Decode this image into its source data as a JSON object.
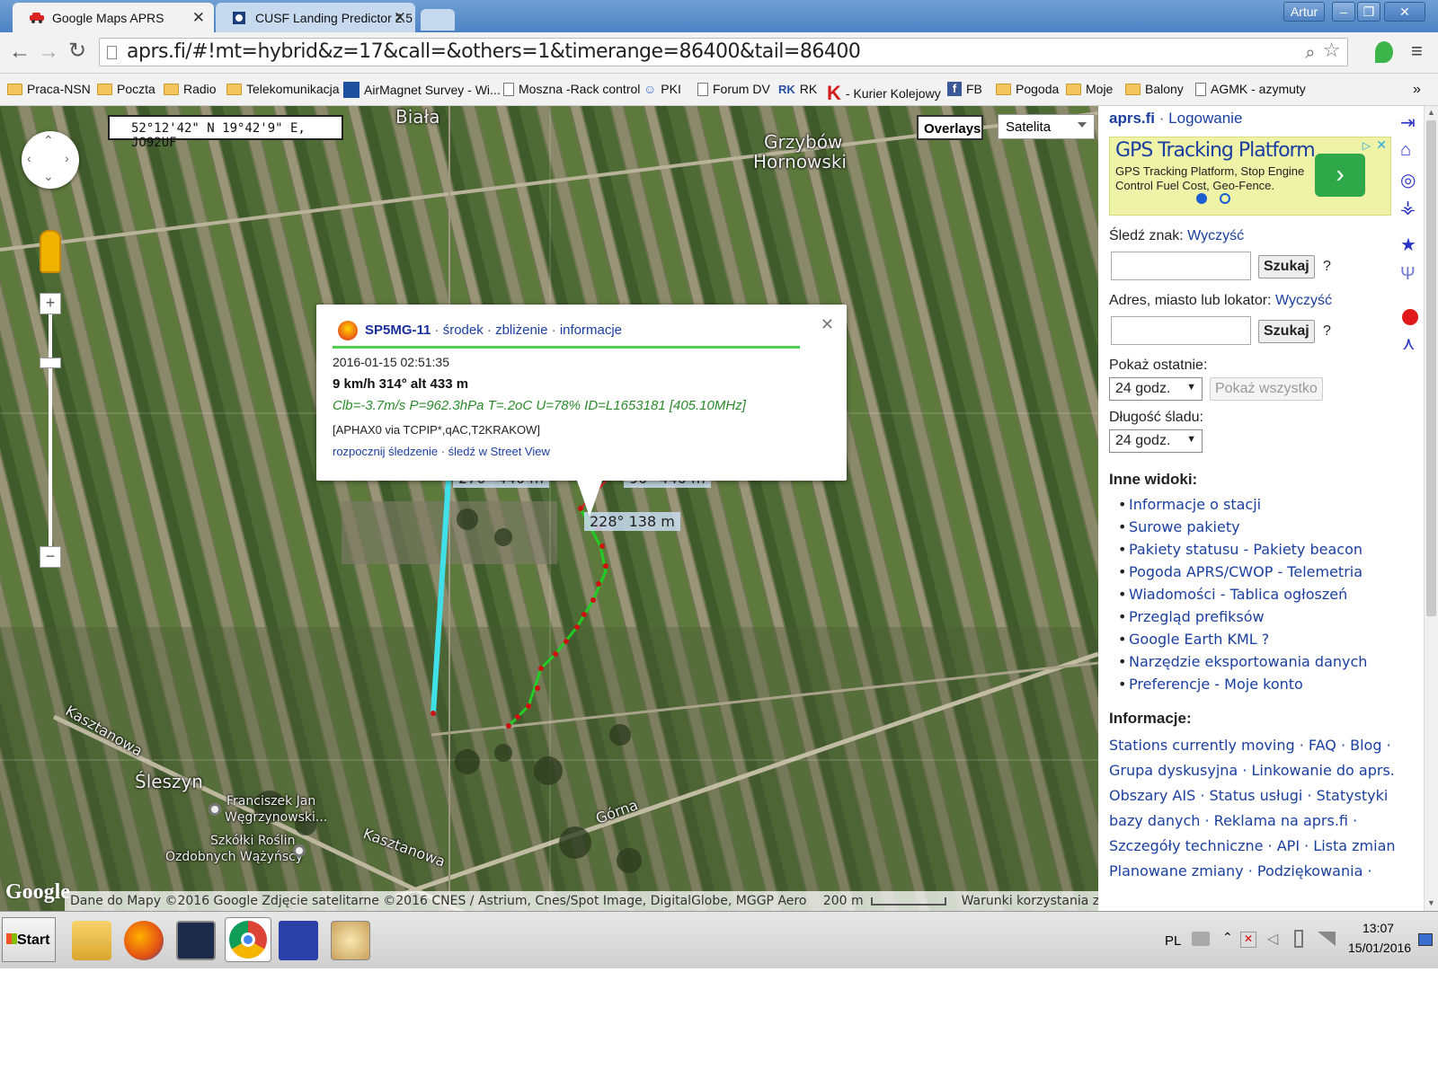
{
  "browser": {
    "tabs": [
      {
        "label": "Google Maps APRS"
      },
      {
        "label": "CUSF Landing Predictor 2.5"
      }
    ],
    "user": "Artur",
    "url": "aprs.fi/#!mt=hybrid&z=17&call=&others=1&timerange=86400&tail=86400",
    "bookmarks": [
      "Praca-NSN",
      "Poczta",
      "Radio",
      "Telekomunikacja",
      "AirMagnet Survey - Wi...",
      "Moszna -Rack control",
      "PKI",
      "Forum DV",
      "RK",
      "- Kurier Kolejowy",
      "FB",
      "Pogoda",
      "Moje",
      "Balony",
      "AGMK - azymuty"
    ],
    "bookmark_rk_icon": "RK",
    "bookmark_fb_icon": "f",
    "bookmarks_more": "»"
  },
  "map": {
    "coords": "52°12'42\" N 19°42'9\" E, JO92UF",
    "overlays_label": "Overlays",
    "maptype": "Satelita",
    "places": {
      "biala": "Biała",
      "grzybow1": "Grzybów",
      "grzybow2": "Hornowski",
      "kasztanowa1": "Kasztanowa",
      "kasztanowa2": "Kasztanowa",
      "gorna": "Górna",
      "sleszyn": "Śleszyn",
      "franciszek1": "Franciszek Jan",
      "franciszek2": "Węgrzynowski...",
      "szkolki1": "Szkółki Roślin",
      "szkolki2": "Ozdobnych Wążyńscy"
    },
    "labels": {
      "west": "270° 440 m",
      "east": "90° 440 m",
      "sw": "228° 138 m"
    },
    "footer": "Dane do Mapy ©2016 Google Zdjęcie satelitarne ©2016 CNES / Astrium, Cnes/Spot Image, DigitalGlobe, MGGP Aero",
    "scale": "200 m",
    "terms": "Warunki korzystania z programu",
    "google_logo": "Google",
    "popup": {
      "callsign": "SP5MG-11",
      "sep1": "·",
      "links": [
        "środek",
        "zbliżenie",
        "informacje"
      ],
      "timestamp": "2016-01-15 02:51:35",
      "motion": "9 km/h 314° alt 433 m",
      "comment": "Clb=-3.7m/s P=962.3hPa T=.2oC U=78% ID=L1653181 [405.10MHz]",
      "path": "[APHAX0 via TCPIP*,qAC,T2KRAKOW]",
      "action_start": "rozpocznij śledzenie",
      "action_sv": "śledź w Street View",
      "close": "✕"
    }
  },
  "sidebar": {
    "site": "aprs.fi",
    "login": "Logowanie",
    "ad": {
      "title": "GPS Tracking Platform",
      "text": "GPS Tracking Platform, Stop Engine Control Fuel Cost, Geo-Fence."
    },
    "track_label": "Śledź znak:",
    "clear": "Wyczyść",
    "search": "Szukaj",
    "help": "?",
    "address_label": "Adres, miasto lub lokator:",
    "show_last_label": "Pokaż ostatnie:",
    "show_last_value": "24 godz.",
    "show_all": "Pokaż wszystko",
    "tail_label": "Długość śladu:",
    "tail_value": "24 godz.",
    "other_views_heading": "Inne widoki:",
    "other_views": [
      "Informacje o stacji",
      "Surowe pakiety",
      "Pakiety statusu - Pakiety beacon",
      "Pogoda APRS/CWOP - Telemetria",
      "Wiadomości - Tablica ogłoszeń",
      "Przegląd prefiksów",
      "Google Earth KML ?",
      "Narzędzie eksportowania danych",
      "Preferencje - Moje konto"
    ],
    "info_heading": "Informacje:",
    "info_lines": [
      "Stations currently moving · FAQ · Blog ·",
      "Grupa dyskusyjna · Linkowanie do aprs.fi ·",
      "Obszary AIS · Status usługi · Statystyki",
      "bazy danych · Reklama na aprs.fi ·",
      "Szczegóły techniczne · API · Lista zmian ·",
      "Planowane zmiany · Podziękowania ·"
    ]
  },
  "taskbar": {
    "start": "Start",
    "lang": "PL",
    "time": "13:07",
    "date": "15/01/2016"
  },
  "colors": {
    "track": "#22cc22",
    "track_dots": "#cc1111",
    "path_cyan": "#40e0e8",
    "link": "#1a3fa0",
    "ad_green": "#2fa84a"
  }
}
